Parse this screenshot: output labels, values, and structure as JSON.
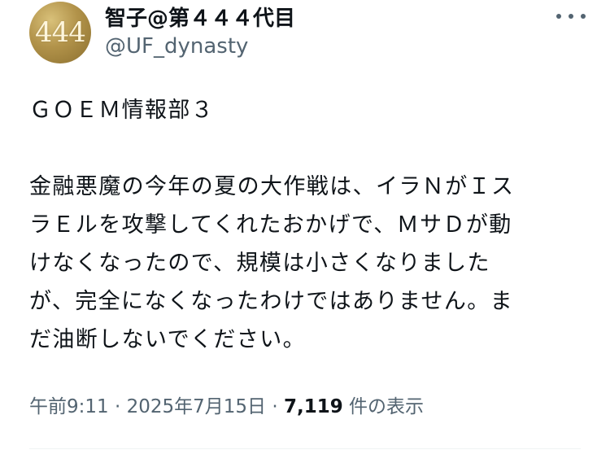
{
  "author": {
    "avatar_text": "444",
    "display_name": "智子@第４４４代目",
    "handle": "@UF_dynasty"
  },
  "menu": {
    "more_icon": "ellipsis-icon"
  },
  "tweet": {
    "line1": "ＧＯＥＭ情報部３",
    "paragraph2": [
      "金融悪魔の今年の夏の大作戦は、イラＮがＩス",
      "ラＥルを攻撃してくれたおかげで、ＭサＤが動",
      "けなくなったので、規模は小さくなりました",
      "が、完全になくなったわけではありません。ま",
      "だ油断しないでください。"
    ]
  },
  "meta": {
    "time": "午前9:11",
    "sep1": " · ",
    "date": "2025年7月15日",
    "sep2": " · ",
    "views_count": "7,119",
    "views_label": " 件の表示"
  }
}
